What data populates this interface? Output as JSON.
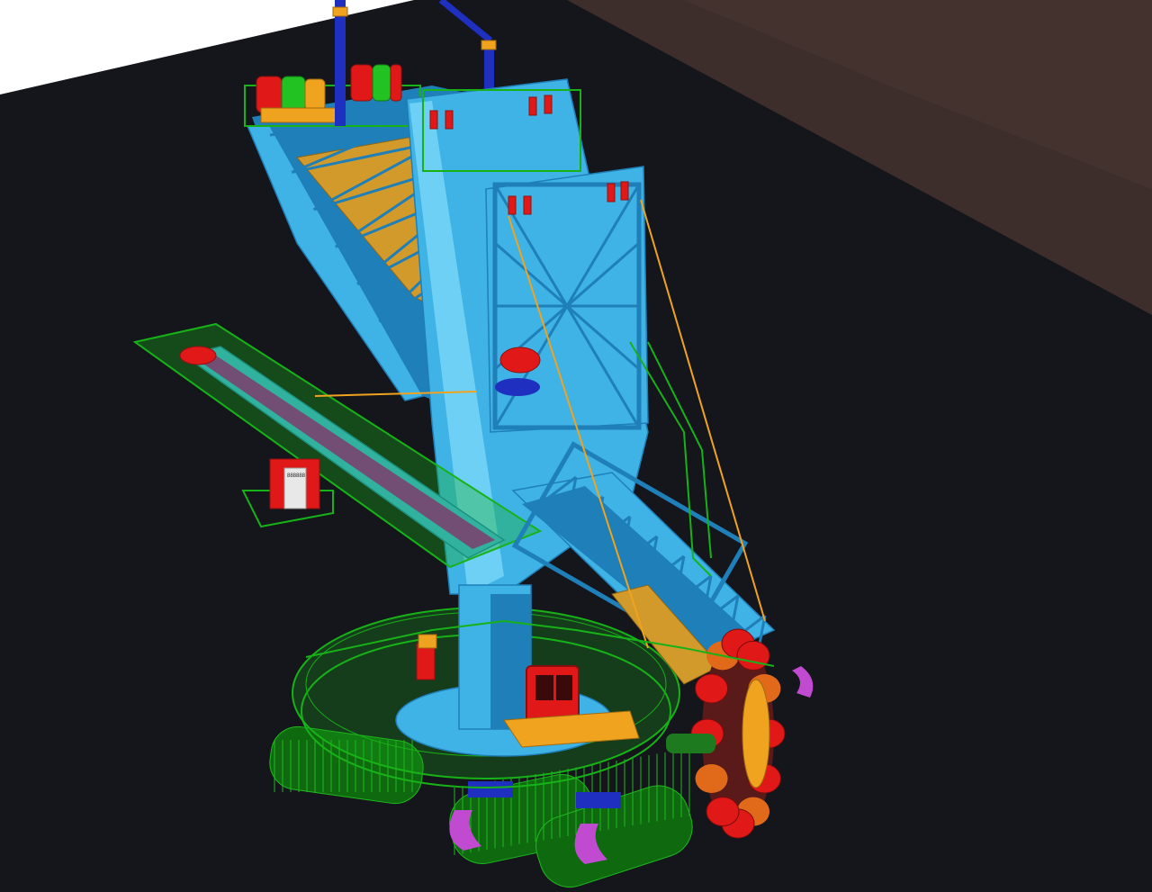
{
  "viewport": {
    "background": "#15151c",
    "frame_color": "#d6d6d6"
  },
  "scene": {
    "subject": "bucket-wheel-excavator-cad-model",
    "palette": {
      "structure": "#3fb3e6",
      "structure_dark": "#1f7fb8",
      "structure_light": "#6fd0f5",
      "railing": "#17b217",
      "crawler": "#0f6a0f",
      "bucket_wheel": "#e01818",
      "bucket_orange": "#e06a1a",
      "cabin_yellow": "#f0a31e",
      "cable": "#f0a31e",
      "conveyor_belt": "#a419a8",
      "crawler_pad": "#c04bd1",
      "mast_blue": "#1f2fbf",
      "background_white": "#ffffff",
      "background_brown": "#3e2e2b"
    },
    "pad_tag": "888888"
  }
}
